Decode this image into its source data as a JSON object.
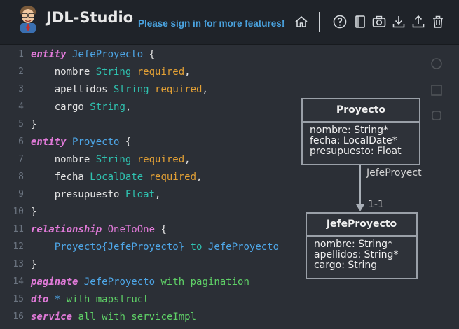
{
  "header": {
    "app_title": "JDL-Studio",
    "signin_text": "Please sign in for more features!",
    "icons": [
      "home-icon",
      "help-icon",
      "book-icon",
      "camera-icon",
      "download-icon",
      "upload-icon",
      "trash-icon"
    ]
  },
  "editor": {
    "lines": [
      {
        "n": "1",
        "tokens": [
          [
            "kw",
            "entity"
          ],
          [
            "pun",
            " "
          ],
          [
            "ent",
            "JefeProyecto"
          ],
          [
            "pun",
            " {"
          ]
        ]
      },
      {
        "n": "2",
        "tokens": [
          [
            "pun",
            "    nombre "
          ],
          [
            "typ",
            "String"
          ],
          [
            "pun",
            " "
          ],
          [
            "req",
            "required"
          ],
          [
            "pun",
            ","
          ]
        ]
      },
      {
        "n": "3",
        "tokens": [
          [
            "pun",
            "    apellidos "
          ],
          [
            "typ",
            "String"
          ],
          [
            "pun",
            " "
          ],
          [
            "req",
            "required"
          ],
          [
            "pun",
            ","
          ]
        ]
      },
      {
        "n": "4",
        "tokens": [
          [
            "pun",
            "    cargo "
          ],
          [
            "typ",
            "String"
          ],
          [
            "pun",
            ","
          ]
        ]
      },
      {
        "n": "5",
        "tokens": [
          [
            "pun",
            "}"
          ]
        ]
      },
      {
        "n": "6",
        "tokens": [
          [
            "kw",
            "entity"
          ],
          [
            "pun",
            " "
          ],
          [
            "ent",
            "Proyecto"
          ],
          [
            "pun",
            " {"
          ]
        ]
      },
      {
        "n": "7",
        "tokens": [
          [
            "pun",
            "    nombre "
          ],
          [
            "typ",
            "String"
          ],
          [
            "pun",
            " "
          ],
          [
            "req",
            "required"
          ],
          [
            "pun",
            ","
          ]
        ]
      },
      {
        "n": "8",
        "tokens": [
          [
            "pun",
            "    fecha "
          ],
          [
            "typ",
            "LocalDate"
          ],
          [
            "pun",
            " "
          ],
          [
            "req",
            "required"
          ],
          [
            "pun",
            ","
          ]
        ]
      },
      {
        "n": "9",
        "tokens": [
          [
            "pun",
            "    presupuesto "
          ],
          [
            "typ",
            "Float"
          ],
          [
            "pun",
            ","
          ]
        ]
      },
      {
        "n": "10",
        "tokens": [
          [
            "pun",
            "}"
          ]
        ]
      },
      {
        "n": "11",
        "tokens": [
          [
            "kw",
            "relationship"
          ],
          [
            "pun",
            " "
          ],
          [
            "kw2",
            "OneToOne"
          ],
          [
            "pun",
            " {"
          ]
        ]
      },
      {
        "n": "12",
        "tokens": [
          [
            "pun",
            "    "
          ],
          [
            "ent",
            "Proyecto{JefeProyecto}"
          ],
          [
            "pun",
            " "
          ],
          [
            "typ",
            "to"
          ],
          [
            "pun",
            " "
          ],
          [
            "ent",
            "JefeProyecto"
          ]
        ]
      },
      {
        "n": "13",
        "tokens": [
          [
            "pun",
            "}"
          ]
        ]
      },
      {
        "n": "14",
        "tokens": [
          [
            "kw",
            "paginate"
          ],
          [
            "pun",
            " "
          ],
          [
            "ent",
            "JefeProyecto"
          ],
          [
            "pun",
            " "
          ],
          [
            "grn",
            "with pagination"
          ]
        ]
      },
      {
        "n": "15",
        "tokens": [
          [
            "kw",
            "dto"
          ],
          [
            "pun",
            " "
          ],
          [
            "ent",
            "*"
          ],
          [
            "pun",
            " "
          ],
          [
            "grn",
            "with mapstruct"
          ]
        ]
      },
      {
        "n": "16",
        "tokens": [
          [
            "kw",
            "service"
          ],
          [
            "pun",
            " "
          ],
          [
            "grn",
            "all with serviceImpl"
          ]
        ]
      }
    ]
  },
  "diagram": {
    "proyecto": {
      "title": "Proyecto",
      "fields": [
        "nombre: String*",
        "fecha: LocalDate*",
        "presupuesto: Float"
      ]
    },
    "jefe": {
      "title": "JefeProyecto",
      "fields": [
        "nombre: String*",
        "apellidos: String*",
        "cargo: String"
      ]
    },
    "relation_label": "JefeProyect",
    "cardinality": "1-1"
  },
  "colors": {
    "keyword": "#e07ad8",
    "entity": "#4ea7e8",
    "type": "#2fc2b0",
    "required": "#e2a035",
    "option": "#5fd167",
    "signin": "#4aa3e0"
  }
}
